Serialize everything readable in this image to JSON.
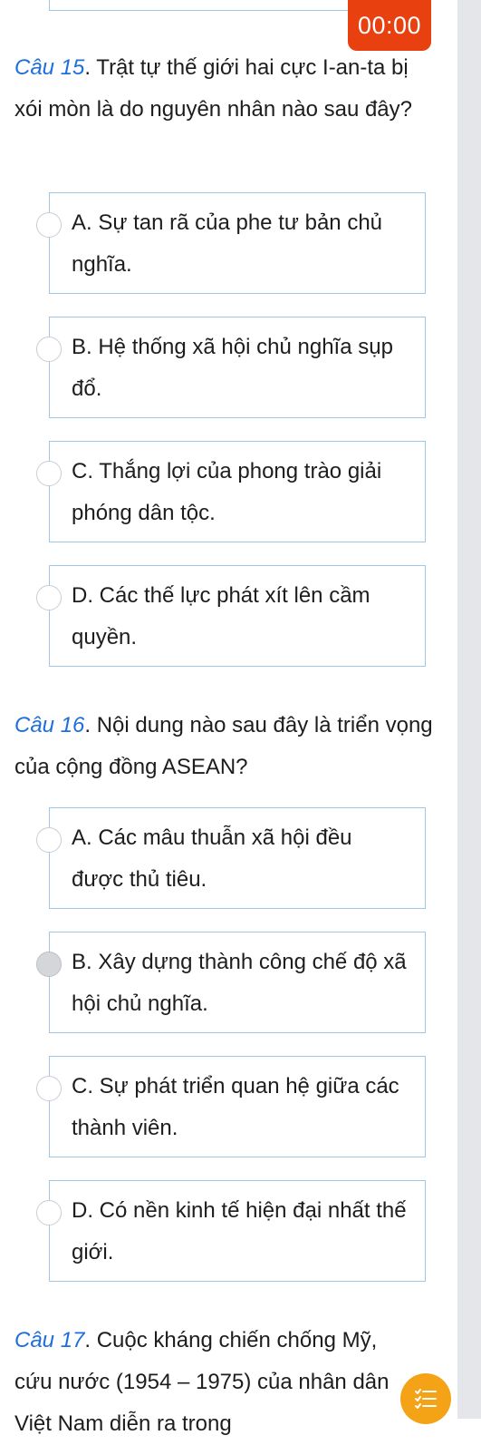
{
  "timer": {
    "value": "00:00"
  },
  "questions": [
    {
      "number": "Câu 15",
      "text": ". Trật tự thế giới hai cực I-an-ta bị xói mòn là do nguyên nhân nào sau đây?",
      "options": [
        "A. Sự tan rã của phe tư bản chủ nghĩa.",
        "B. Hệ thống xã hội chủ nghĩa sụp đổ.",
        "C. Thắng lợi của phong trào giải phóng dân tộc.",
        "D. Các thế lực phát xít lên cầm quyền."
      ]
    },
    {
      "number": "Câu 16",
      "text": ". Nội dung nào sau đây là triển vọng của cộng đồng ASEAN?",
      "options": [
        "A. Các mâu thuẫn xã hội đều được thủ tiêu.",
        "B. Xây dựng thành công chế độ xã hội chủ nghĩa.",
        "C. Sự phát triển quan hệ giữa các thành viên.",
        "D. Có nền kinh tế hiện đại nhất thế giới."
      ],
      "selected_option": "B"
    },
    {
      "number": "Câu 17",
      "text": ". Cuộc kháng chiến chống Mỹ, cứu nước (1954 – 1975) của nhân dân Việt Nam diễn ra trong"
    }
  ],
  "fab": {
    "icon": "list-icon",
    "color": "#f5a316"
  },
  "colors": {
    "accent": "#1e6fd9",
    "timer": "#e8400e",
    "option_border": "#9ec7e8"
  }
}
